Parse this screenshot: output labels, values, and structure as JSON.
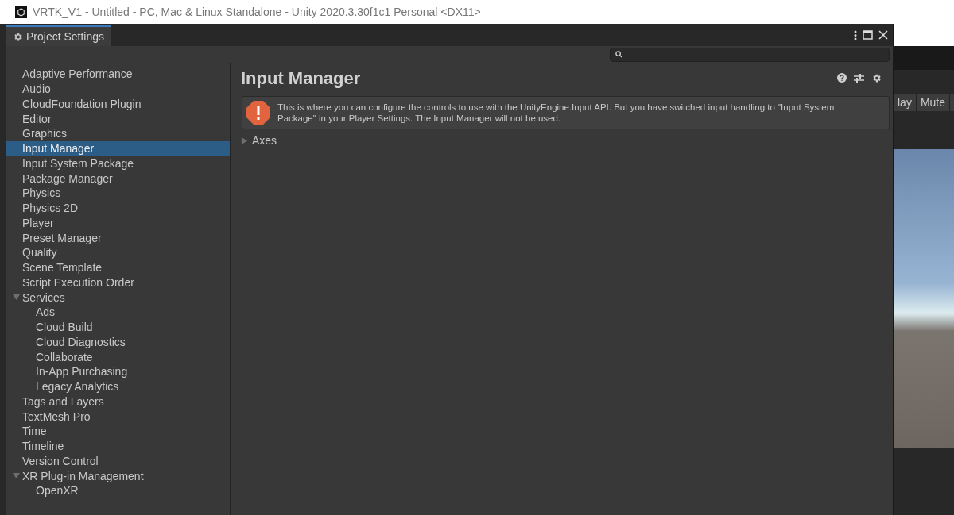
{
  "app_title": "VRTK_V1 - Untitled - PC, Mac & Linux Standalone - Unity 2020.3.30f1c1 Personal <DX11>",
  "window": {
    "tab": "Project Settings"
  },
  "sidebar": {
    "items": [
      {
        "label": "Adaptive Performance",
        "selected": false
      },
      {
        "label": "Audio",
        "selected": false
      },
      {
        "label": "CloudFoundation Plugin",
        "selected": false
      },
      {
        "label": "Editor",
        "selected": false
      },
      {
        "label": "Graphics",
        "selected": false
      },
      {
        "label": "Input Manager",
        "selected": true
      },
      {
        "label": "Input System Package",
        "selected": false
      },
      {
        "label": "Package Manager",
        "selected": false
      },
      {
        "label": "Physics",
        "selected": false
      },
      {
        "label": "Physics 2D",
        "selected": false
      },
      {
        "label": "Player",
        "selected": false
      },
      {
        "label": "Preset Manager",
        "selected": false
      },
      {
        "label": "Quality",
        "selected": false
      },
      {
        "label": "Scene Template",
        "selected": false
      },
      {
        "label": "Script Execution Order",
        "selected": false
      },
      {
        "label": "Services",
        "selected": false,
        "expanded": true,
        "children": [
          {
            "label": "Ads",
            "selected": false
          },
          {
            "label": "Cloud Build",
            "selected": false
          },
          {
            "label": "Cloud Diagnostics",
            "selected": false
          },
          {
            "label": "Collaborate",
            "selected": false
          },
          {
            "label": "In-App Purchasing",
            "selected": false
          },
          {
            "label": "Legacy Analytics",
            "selected": false
          }
        ]
      },
      {
        "label": "Tags and Layers",
        "selected": false
      },
      {
        "label": "TextMesh Pro",
        "selected": false
      },
      {
        "label": "Time",
        "selected": false
      },
      {
        "label": "Timeline",
        "selected": false
      },
      {
        "label": "Version Control",
        "selected": false
      },
      {
        "label": "XR Plug-in Management",
        "selected": false,
        "expanded": true,
        "children": [
          {
            "label": "OpenXR",
            "selected": false
          }
        ]
      }
    ]
  },
  "content": {
    "title": "Input Manager",
    "warning": "This is where you can configure the controls to use with the UnityEngine.Input API. But you have switched input handling to \"Input System Package\" in your Player Settings. The Input Manager will not be used.",
    "sections": [
      {
        "label": "Axes",
        "expanded": false
      }
    ]
  },
  "background_toolbar": [
    "lay",
    "Mute"
  ]
}
